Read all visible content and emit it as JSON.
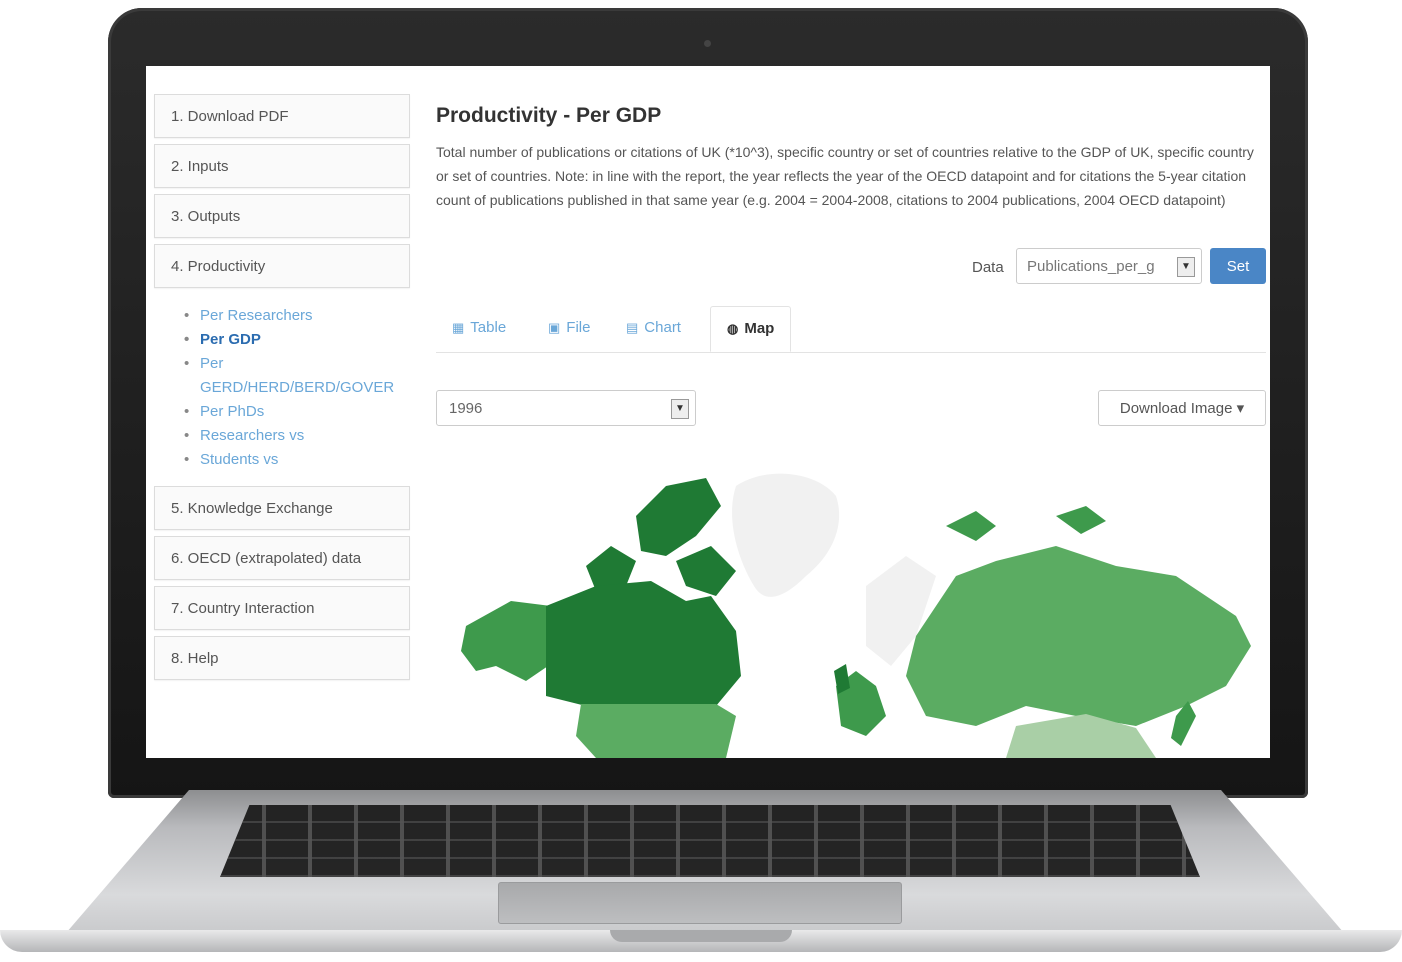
{
  "sidebar": {
    "items": [
      {
        "label": "1. Download PDF"
      },
      {
        "label": "2. Inputs"
      },
      {
        "label": "3. Outputs"
      },
      {
        "label": "4. Productivity"
      },
      {
        "label": "5. Knowledge Exchange"
      },
      {
        "label": "6. OECD (extrapolated) data"
      },
      {
        "label": "7. Country Interaction"
      },
      {
        "label": "8. Help"
      }
    ],
    "subitems": [
      {
        "label": "Per Researchers"
      },
      {
        "label": "Per GDP"
      },
      {
        "label": "Per GERD/HERD/BERD/GOVER"
      },
      {
        "label": "Per PhDs"
      },
      {
        "label": "Researchers vs"
      },
      {
        "label": "Students vs"
      }
    ]
  },
  "main": {
    "title": "Productivity - Per GDP",
    "description": "Total number of publications or citations of UK (*10^3), specific country or set of countries relative to the GDP of UK, specific country or set of countries. Note: in line with the report, the year reflects the year of the OECD datapoint and for citations the 5-year citation count of publications published in that same year (e.g. 2004 = 2004-2008, citations to 2004 publications, 2004 OECD datapoint)",
    "data_label": "Data",
    "data_value": "Publications_per_g",
    "set_label": "Set",
    "tabs": [
      {
        "label": "Table",
        "icon": "table-icon"
      },
      {
        "label": "File",
        "icon": "save-icon"
      },
      {
        "label": "Chart",
        "icon": "chart-icon"
      },
      {
        "label": "Map",
        "icon": "globe-icon"
      }
    ],
    "active_tab": "Map",
    "year_value": "1996",
    "download_label": "Download Image ▾"
  },
  "colors": {
    "map_dark": "#1f7a34",
    "map_mid": "#3e9a4c",
    "map_light": "#7cc07e",
    "map_pale": "#a9cfa6",
    "map_empty": "#f1f1f1",
    "link": "#6aa7d8",
    "button": "#4a86c6"
  }
}
